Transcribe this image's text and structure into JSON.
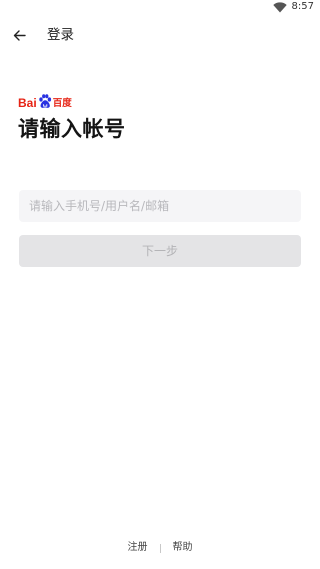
{
  "status_bar": {
    "time": "8:57",
    "icons": [
      "wifi-icon"
    ]
  },
  "app_bar": {
    "back_icon": "arrow-left-icon",
    "title": "登录"
  },
  "logo": {
    "latin": "Bai",
    "chinese": "百度",
    "brand_color": "#e62314"
  },
  "heading": "请输入帐号",
  "account_input": {
    "value": "",
    "placeholder": "请输入手机号/用户名/邮箱"
  },
  "next_button": {
    "label": "下一步",
    "enabled": false
  },
  "footer": {
    "register_label": "注册",
    "help_label": "帮助"
  }
}
